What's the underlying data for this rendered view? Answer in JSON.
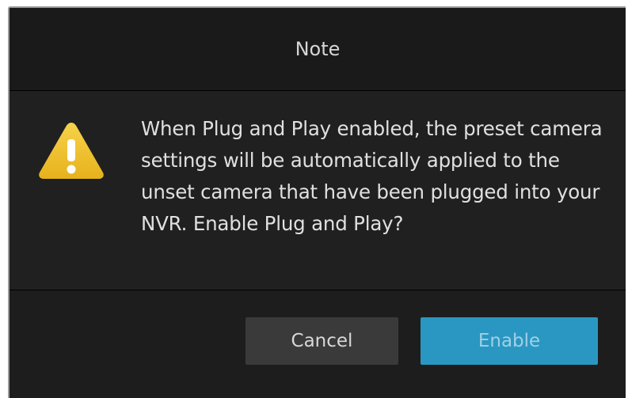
{
  "dialog": {
    "title": "Note",
    "message": "When Plug and Play enabled, the preset camera settings will be automatically applied to the unset camera that have been plugged into your NVR. Enable Plug and Play?",
    "icon": "warning-icon",
    "buttons": {
      "cancel_label": "Cancel",
      "enable_label": "Enable"
    }
  },
  "colors": {
    "background": "#1d1d1d",
    "text": "#e0e0e0",
    "accent": "#2a97c2",
    "warning": "#f2c230"
  }
}
